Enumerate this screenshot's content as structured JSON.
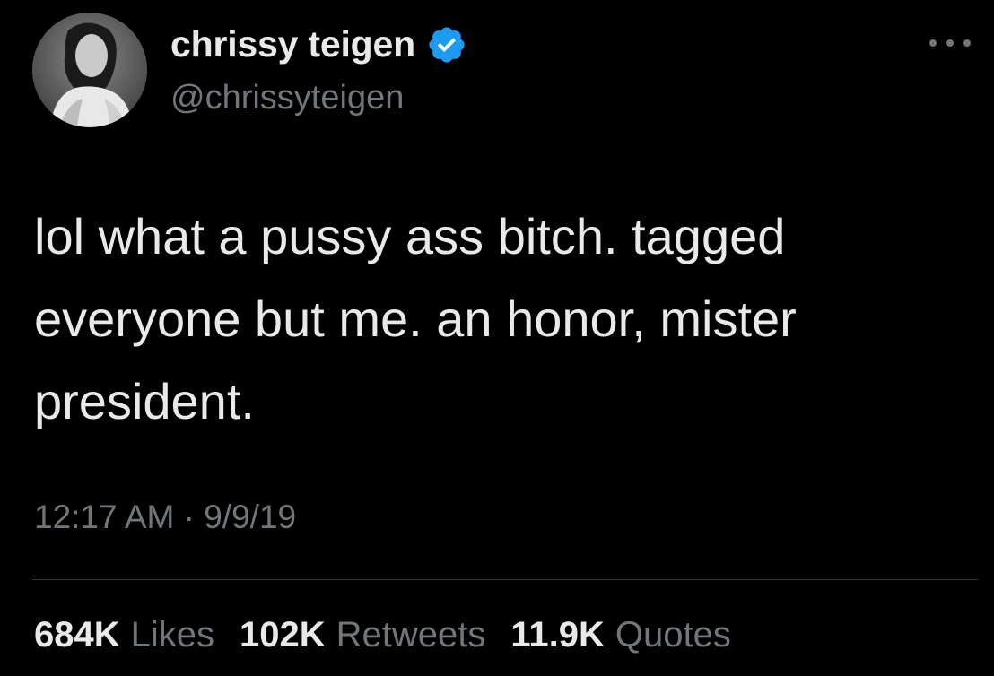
{
  "author": {
    "display_name": "chrissy teigen",
    "handle": "@chrissyteigen",
    "verified": true,
    "avatar_icon": "profile-photo",
    "verified_color": "#1d9bf0"
  },
  "tweet": {
    "lines": [
      "lol what a pussy ass bitch. tagged",
      "everyone but me. an honor, mister",
      "president."
    ],
    "time": "12:17 AM",
    "separator": "·",
    "date": "9/9/19"
  },
  "stats": {
    "likes_count": "684K",
    "likes_label": "Likes",
    "retweets_count": "102K",
    "retweets_label": "Retweets",
    "quotes_count": "11.9K",
    "quotes_label": "Quotes"
  },
  "colors": {
    "background": "#000000",
    "primary_text": "#e7e9ea",
    "secondary_text": "#71767b",
    "divider": "#2f3336"
  }
}
